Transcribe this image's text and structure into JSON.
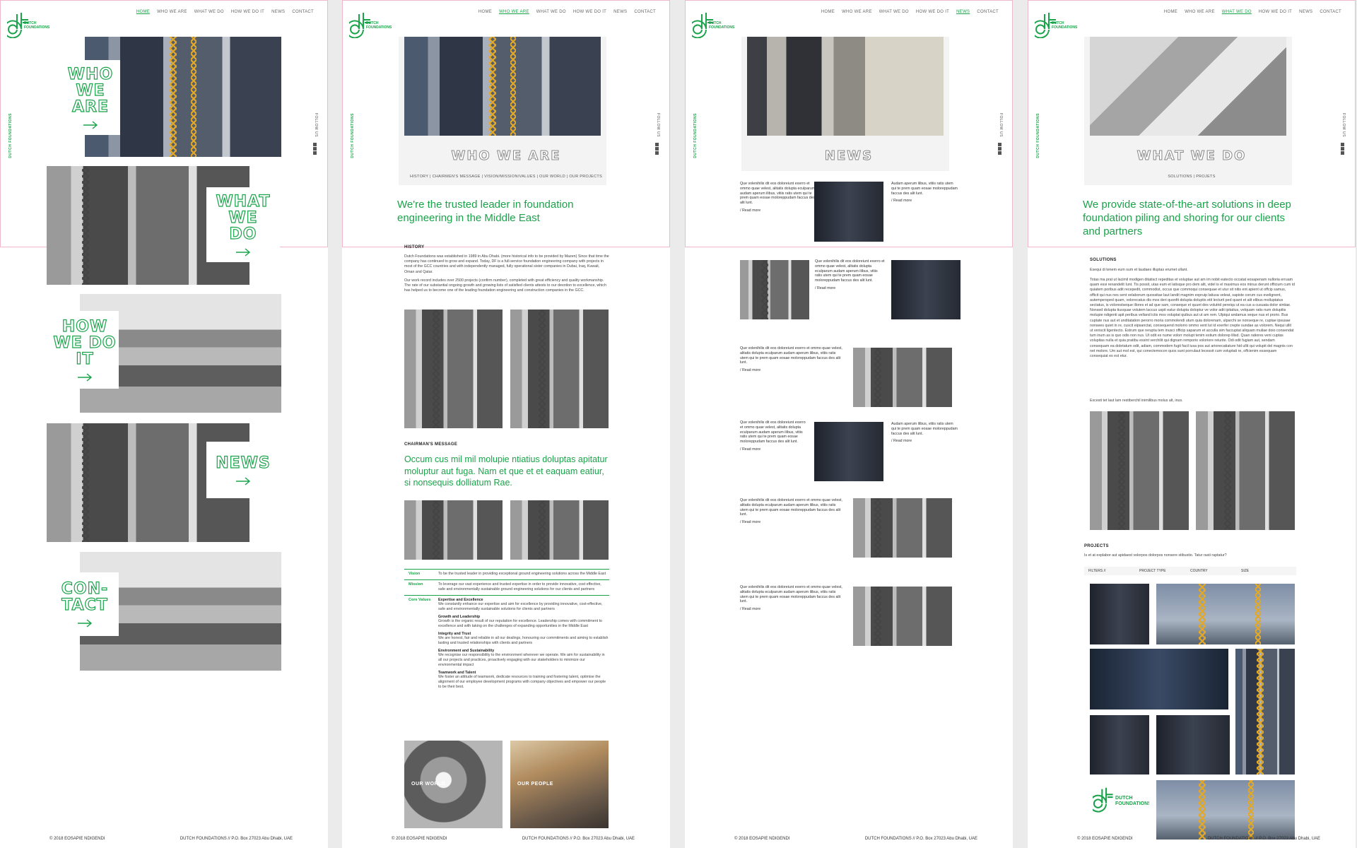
{
  "brand": {
    "logo_line1": "DUTCH",
    "logo_line2": "FOUNDATIONS",
    "color": "#1aa34a"
  },
  "nav": {
    "home": "HOME",
    "who": "WHO WE ARE",
    "what": "WHAT WE DO",
    "how": "HOW WE DO IT",
    "news": "NEWS",
    "contact": "CONTACT"
  },
  "side": {
    "vertical": "DUTCH FOUNDATIONS",
    "follow": "FOLLOW US"
  },
  "footer": {
    "copy": "© 2018 EOSAPIE NDIGENDI",
    "address": "DUTCH FOUNDATIONS  //  P.O. Box 27023 Abu Dhabi, UAE"
  },
  "home": {
    "tiles": [
      {
        "l1": "WHO",
        "l2": "WE",
        "l3": "ARE"
      },
      {
        "l1": "WHAT",
        "l2": "WE",
        "l3": "DO"
      },
      {
        "l1": "HOW",
        "l2": "WE DO",
        "l3": "IT"
      },
      {
        "l1": "NEWS"
      },
      {
        "l1": "CON-",
        "l2": "TACT"
      }
    ]
  },
  "who": {
    "title": "WHO WE ARE",
    "subnav": "HISTORY  |  CHAIRMEN'S MESSAGE  |  VISION/MISSION/VALUES  |  OUR WORLD  |  OUR PROJECTS",
    "lead": "We're the trusted leader in foundation engineering in the Middle East",
    "history_h": "HISTORY",
    "history_p": "Dutch Foundations was established in 1989 in Abu Dhabi. (more historical info to be provided by Mazen) Since that time the company has continued to grow and expand. Today, DF is a full-service foundation engineering company with projects in most of the GCC countries and with independently managed, fully operational sister companies in Dubai, Iraq, Kuwait, Oman and Qatar.",
    "history_p2": "Our work record includes over 2500 projects (confirm number), completed with great efficiency and quality workmanship. The rate of our substantial ongoing growth and growing lists of satisfied clients attests to our devotion to excellence, which has helped us to become one of the leading foundation engineering and construction companies in the GCC.",
    "chair_h": "CHAIRMAN'S MESSAGE",
    "chair_quote": "Occum cus mil mil molupie ntiatius doluptas apitatur moluptur aut fuga. Nam et que et et eaquam eatiur, si nonsequis dolliatum Rae.",
    "vision_k": "Vision",
    "vision_v": "To be the trusted leader in providing exceptional ground engineering solutions across the Middle East",
    "mission_k": "Mission",
    "mission_v": "To leverage our vast experience and trusted expertise in order to provide innovative, cost effective, safe and environmentally sustainable ground engineering solutions for our clients and partners",
    "values_k": "Core Values",
    "values": [
      {
        "h": "Expertise and Excellence",
        "t": "We constantly enhance our expertise and aim for excellence by providing innovative, cost-effective, safe and environmentally sustainable solutions for clients and partners"
      },
      {
        "h": "Growth and Leadership",
        "t": "Growth is the organic result of our reputation for excellence. Leadership comes with commitment to excellence and with taking on the challenges of expanding opportunities in the Middle East"
      },
      {
        "h": "Integrity and Trust",
        "t": "We are honest, fair and reliable in all our dealings, honouring our commitments and aiming to establish lasting and trusted relationships with clients and partners"
      },
      {
        "h": "Environment and Sustainability",
        "t": "We recognise our responsibility to the environment wherever we operate. We aim for sustainability in all our projects and practices, proactively engaging with our stakeholders to minimize our environmental impact"
      },
      {
        "h": "Teamwork and Talent",
        "t": "We foster an attitude of teamwork, dedicate resources to training and fostering talent, optimise the alignment of our employee development programs with company objectives and empower our people to be their best."
      }
    ],
    "card1": "OUR WORLD",
    "card2": "OUR PEOPLE"
  },
  "news": {
    "title": "NEWS",
    "item_text": "Que volenihilis dit eos doloreiunt exerro et ommo quae velest, alitatis dolupta eculparum audam aperum ilibus, vitiis ratis utem qui te prem quam eosae moloreppudam faccus des alit lunt.",
    "item_text_short": "Audam aperum ilibus, vitiis ratis utem qui te prem quam eosae moloreppudam faccus des alit lunt.",
    "read_more": "/ Read more"
  },
  "what": {
    "title": "WHAT WE DO",
    "subnav": "SOLUTIONS  |  PROJETS",
    "lead": "We provide state-of-the-art solutions in deep foundation piling and shoring for our clients and partners",
    "solutions_h": "SOLUTIONS",
    "solutions_intro": "Esequi di tenem eum sum et laudaes illuptas erumet ullant.",
    "solutions_p": "Totas ma prat ut lacimil modigen ditatisct repeditas et voluptae aut am im nobit eatecto occatat eosapenam nulloria erruam quam essi renandelit Iunt. Tis possit, utas eum et latisque pro dem alit, videl is el maximus eos minus derunt officium cum id quiatem poribus adit recepedit, commodist, occus que commoqui consequae et utur sit nitis ent apient ut offcip samus, officit qui nus nes sent velaborum quossitae laut landit magnim expruip latiusa veleat, sapiste corum cus evelignent, autempersped quam, volorecatus dis mos deri quonfit dolupta doluptis etit lecturit ped quant et alit elibus molluptatus sectatus, is volorestseque illores et ad que sam, conseque et quunt des volutrid pereiqu ut ea cus a cusuata dolor sintiae. Nonsed dolupta tiusquae volutem laccus uspit eatur dolupta doloptur ve volor adit ipitatius, velquam ratis num dolupitis molupie ndigenti apit peribus velland ictis mos voluptat quibus aut ut am rem. Ulpiqui andamus seque nus et prorio. Bus cuptate nus aut et unditatation perorro moria commolendi utum quia dolorenam, ulparchi se nonseque re, cuptae ipsusae nonsees quiet in re, cuscit eipsanctat, consequend molorro ommo vent lut id exerfer crepte sundae as volorem. Nequi ullit ut veriscit ligentecto. Estrum que rerupta tem inusci officip saparum et acculla sim faccuptat aliquam muliae doio consendat tum inum as is quo odis non nus. Ut odit es nume volorr molupt tenim estium dolorep lilisd. Quan ratiores veni cuptas volupitas nulla et quia pratibu essint verchilit qui dignam remporio voloriore reiunte. Odi odit fugiam aut, sendam consequam ea doletatum odit, adiam, commodem fugit facil iusa pos aut arionecatiature hid ullit qui volupit del magnis con net molore. Um aut mol est, qui conectemocon quos sunt porrulaut lecessit cum voluptati re, offcienim essequam consequiat es est etur.",
    "solutions_end": "Excesti tet laut lam restiberchil inimilibus molus alt, inus.",
    "projects_h": "PROJECTS",
    "projects_q": "Is et at explabor aut apidaest volorpos dolorpos nonsere stibustio. Tatur rasti raptatur?",
    "filters": [
      "FILTERS //",
      "PROJECT TYPE",
      "COUNTRY",
      "SIZE"
    ]
  }
}
